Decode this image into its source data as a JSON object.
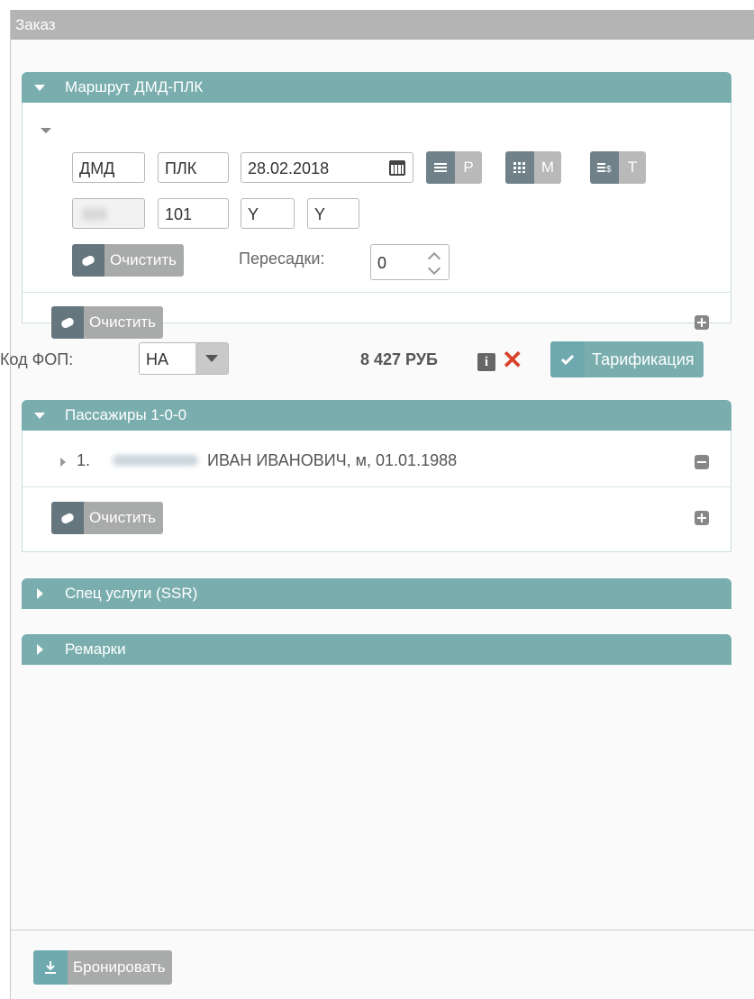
{
  "window": {
    "title": "Заказ"
  },
  "route": {
    "header": "Маршрут ДМД-ПЛК",
    "segment": {
      "from": "ДМД",
      "to": "ПЛК",
      "date": "28.02.2018",
      "carrier": "",
      "flight": "101",
      "class1": "Y",
      "class2": "Y",
      "toggles": [
        {
          "letter": "P",
          "icon": "list-icon"
        },
        {
          "letter": "M",
          "icon": "grid-icon"
        },
        {
          "letter": "T",
          "icon": "tariff-icon"
        }
      ],
      "clear_label": "Очистить",
      "transfers_label": "Пересадки:",
      "transfers_value": "0"
    },
    "clear_label": "Очистить"
  },
  "fop": {
    "label": "Код ФОП:",
    "value": "НА",
    "price": "8 427 РУБ",
    "tariff_label": "Тарификация"
  },
  "passengers": {
    "header": "Пассажиры 1-0-0",
    "items": [
      {
        "num": "1.",
        "surname": "",
        "details": "ИВАН ИВАНОВИЧ, м, 01.01.1988"
      }
    ],
    "clear_label": "Очистить"
  },
  "ssr": {
    "header": "Спец услуги (SSR)"
  },
  "remarks": {
    "header": "Ремарки"
  },
  "footer": {
    "book_label": "Бронировать"
  },
  "colors": {
    "accent": "#7aaeae",
    "title_bar": "#b4b4b4",
    "delete": "#d9412b"
  }
}
